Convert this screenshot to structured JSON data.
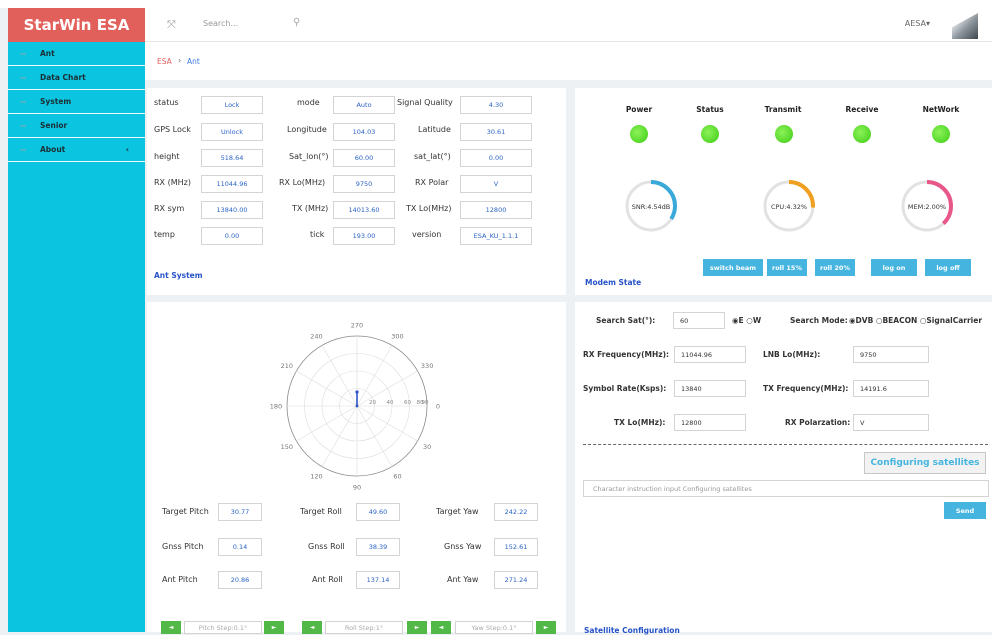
{
  "app": {
    "brand": "StarWin ESA",
    "search_placeholder": "Search...",
    "user": "AESA▾"
  },
  "sidebar": {
    "items": [
      {
        "label": "Ant"
      },
      {
        "label": "Data Chart"
      },
      {
        "label": "System"
      },
      {
        "label": "Senior"
      },
      {
        "label": "About",
        "arrow": "‹"
      }
    ]
  },
  "breadcrumb": {
    "root": "ESA",
    "sep": "›",
    "current": "Ant"
  },
  "ant": {
    "title": "Ant System",
    "status_label": "status",
    "status": "Lock",
    "mode_label": "mode",
    "mode": "Auto",
    "sq_label": "Signal Quality",
    "sq": "4.30",
    "gps_label": "GPS Lock",
    "gps": "Unlock",
    "lon_label": "Longitude",
    "lon": "104.03",
    "lat_label": "Latitude",
    "lat": "30.61",
    "height_label": "height",
    "height": "518.64",
    "satlon_label": "Sat_lon(°)",
    "satlon": "60.00",
    "satlat_label": "sat_lat(°)",
    "satlat": "0.00",
    "rx_label": "RX (MHz)",
    "rx": "11044.96",
    "rxlo_label": "RX Lo(MHz)",
    "rxlo": "9750",
    "rxpol_label": "RX Polar",
    "rxpol": "V",
    "rxsym_label": "RX sym",
    "rxsym": "13840.00",
    "tx_label": "TX (MHz)",
    "tx": "14013.60",
    "txlo_label": "TX Lo(MHz)",
    "txlo": "12800",
    "temp_label": "temp",
    "temp": "0.00",
    "tick_label": "tick",
    "tick": "193.00",
    "version_label": "version",
    "version": "ESA_KU_1.1.1"
  },
  "modem": {
    "title": "Modem State",
    "leds": [
      {
        "label": "Power",
        "color": "#3ccc12"
      },
      {
        "label": "Status",
        "color": "#3ccc12"
      },
      {
        "label": "Transmit",
        "color": "#3ccc12"
      },
      {
        "label": "Receive",
        "color": "#3ccc12"
      },
      {
        "label": "NetWork",
        "color": "#3ccc12"
      }
    ],
    "gauges": [
      {
        "label": "SNR:4.54dB",
        "percent": 34,
        "color": "#3aa8d8"
      },
      {
        "label": "CPU:4.32%",
        "percent": 26,
        "color": "#f0a020"
      },
      {
        "label": "MEM:2.00%",
        "percent": 38,
        "color": "#e8578a"
      }
    ],
    "buttons": [
      "switch beam",
      "roll 15%",
      "roll 20%",
      "log on",
      "log off"
    ]
  },
  "polar": {
    "angle_labels": [
      "0",
      "30",
      "60",
      "90",
      "120",
      "150",
      "180",
      "210",
      "240",
      "270",
      "300",
      "330"
    ],
    "radial_labels": [
      "20",
      "40",
      "60",
      "80",
      "90"
    ]
  },
  "attitude": {
    "target_pitch_label": "Target Pitch",
    "target_pitch": "30.77",
    "target_roll_label": "Target Roll",
    "target_roll": "49.60",
    "target_yaw_label": "Target Yaw",
    "target_yaw": "242.22",
    "gnss_pitch_label": "Gnss Pitch",
    "gnss_pitch": "0.14",
    "gnss_roll_label": "Gnss Roll",
    "gnss_roll": "38.39",
    "gnss_yaw_label": "Gnss Yaw",
    "gnss_yaw": "152.61",
    "ant_pitch_label": "Ant Pitch",
    "ant_pitch": "20.86",
    "ant_roll_label": "Ant Roll",
    "ant_roll": "137.14",
    "ant_yaw_label": "Ant Yaw",
    "ant_yaw": "271.24",
    "pitch_step": "Pitch Step:0.1°",
    "roll_step": "Roll Step:1°",
    "yaw_step": "Yaw Step:0.1°",
    "left_arrow": "◄",
    "right_arrow": "►"
  },
  "sat": {
    "search_label": "Search Sat(°):",
    "search_value": "60",
    "ew": "◉E ○W",
    "mode_label": "Search Mode:",
    "modes": "◉DVB ○BEACON ○SignalCarrier",
    "rxf_label": "RX Frequency(MHz):",
    "rxf": "11044.96",
    "lnb_label": "LNB Lo(MHz):",
    "lnb": "9750",
    "sym_label": "Symbol Rate(Ksps):",
    "sym": "13840",
    "txf_label": "TX Frequency(MHz):",
    "txf": "14191.6",
    "txlo_label": "TX Lo(MHz):",
    "txlo": "12800",
    "rxp_label": "RX Polarzation:",
    "rxp": "V",
    "config_btn": "Configuring satellites",
    "cmd_placeholder": "Character instruction input Configuring satellites",
    "send": "Send",
    "title": "Satellite Configuration"
  }
}
